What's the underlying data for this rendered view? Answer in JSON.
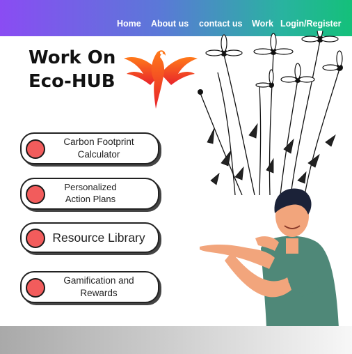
{
  "nav": {
    "home": "Home",
    "about": "About us",
    "contact": "contact us",
    "work": "Work",
    "login": "Login/Register"
  },
  "hero": {
    "title_line1": "Work On",
    "title_line2": "Eco-HUB"
  },
  "features": [
    {
      "label": "Carbon Footprint\nCalculator"
    },
    {
      "label": "Personalized\nAction Plans"
    },
    {
      "label": "Resource Library"
    },
    {
      "label": "Gamification and\nRewards"
    }
  ],
  "colors": {
    "header_start": "#8a4cf3",
    "header_end": "#14c07a",
    "button_dot": "#f25c5c"
  }
}
